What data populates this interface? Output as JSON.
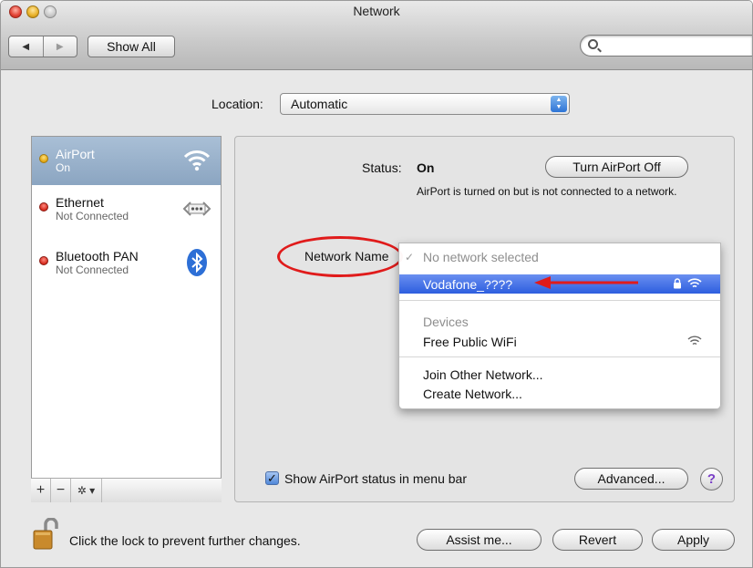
{
  "window": {
    "title": "Network"
  },
  "toolbar": {
    "back_glyph": "◀",
    "forward_glyph": "▶",
    "show_all_label": "Show All",
    "search_value": ""
  },
  "location": {
    "label": "Location:",
    "value": "Automatic"
  },
  "services": [
    {
      "name": "AirPort",
      "status": "On",
      "status_color": "#e0a40e",
      "icon": "wifi-icon",
      "selected": true
    },
    {
      "name": "Ethernet",
      "status": "Not Connected",
      "status_color": "#d4281b",
      "icon": "ethernet-icon",
      "selected": false
    },
    {
      "name": "Bluetooth PAN",
      "status": "Not Connected",
      "status_color": "#d4281b",
      "icon": "bluetooth-icon",
      "selected": false
    }
  ],
  "sidebar_tools": {
    "add": "+",
    "remove": "−",
    "action": "✲ ▾"
  },
  "detail": {
    "status_label": "Status:",
    "status_value": "On",
    "turn_off_label": "Turn AirPort Off",
    "status_description": "AirPort is turned on but is not connected to a network.",
    "network_name_label": "Network Name",
    "network_menu": {
      "current": "No network selected",
      "networks": [
        {
          "name": "Vodafone_????",
          "locked": true,
          "highlighted": true
        }
      ],
      "devices_header": "Devices",
      "devices": [
        {
          "name": "Free Public WiFi"
        }
      ],
      "actions": [
        "Join Other Network...",
        "Create Network..."
      ]
    },
    "show_status_label": "Show AirPort status in menu bar",
    "show_status_checked": true,
    "advanced_label": "Advanced...",
    "help_label": "?"
  },
  "footer": {
    "lock_text": "Click the lock to prevent further changes.",
    "assist_label": "Assist me...",
    "revert_label": "Revert",
    "apply_label": "Apply"
  },
  "colors": {
    "selection": "#2d5edf",
    "annotation": "#e01b1b"
  }
}
